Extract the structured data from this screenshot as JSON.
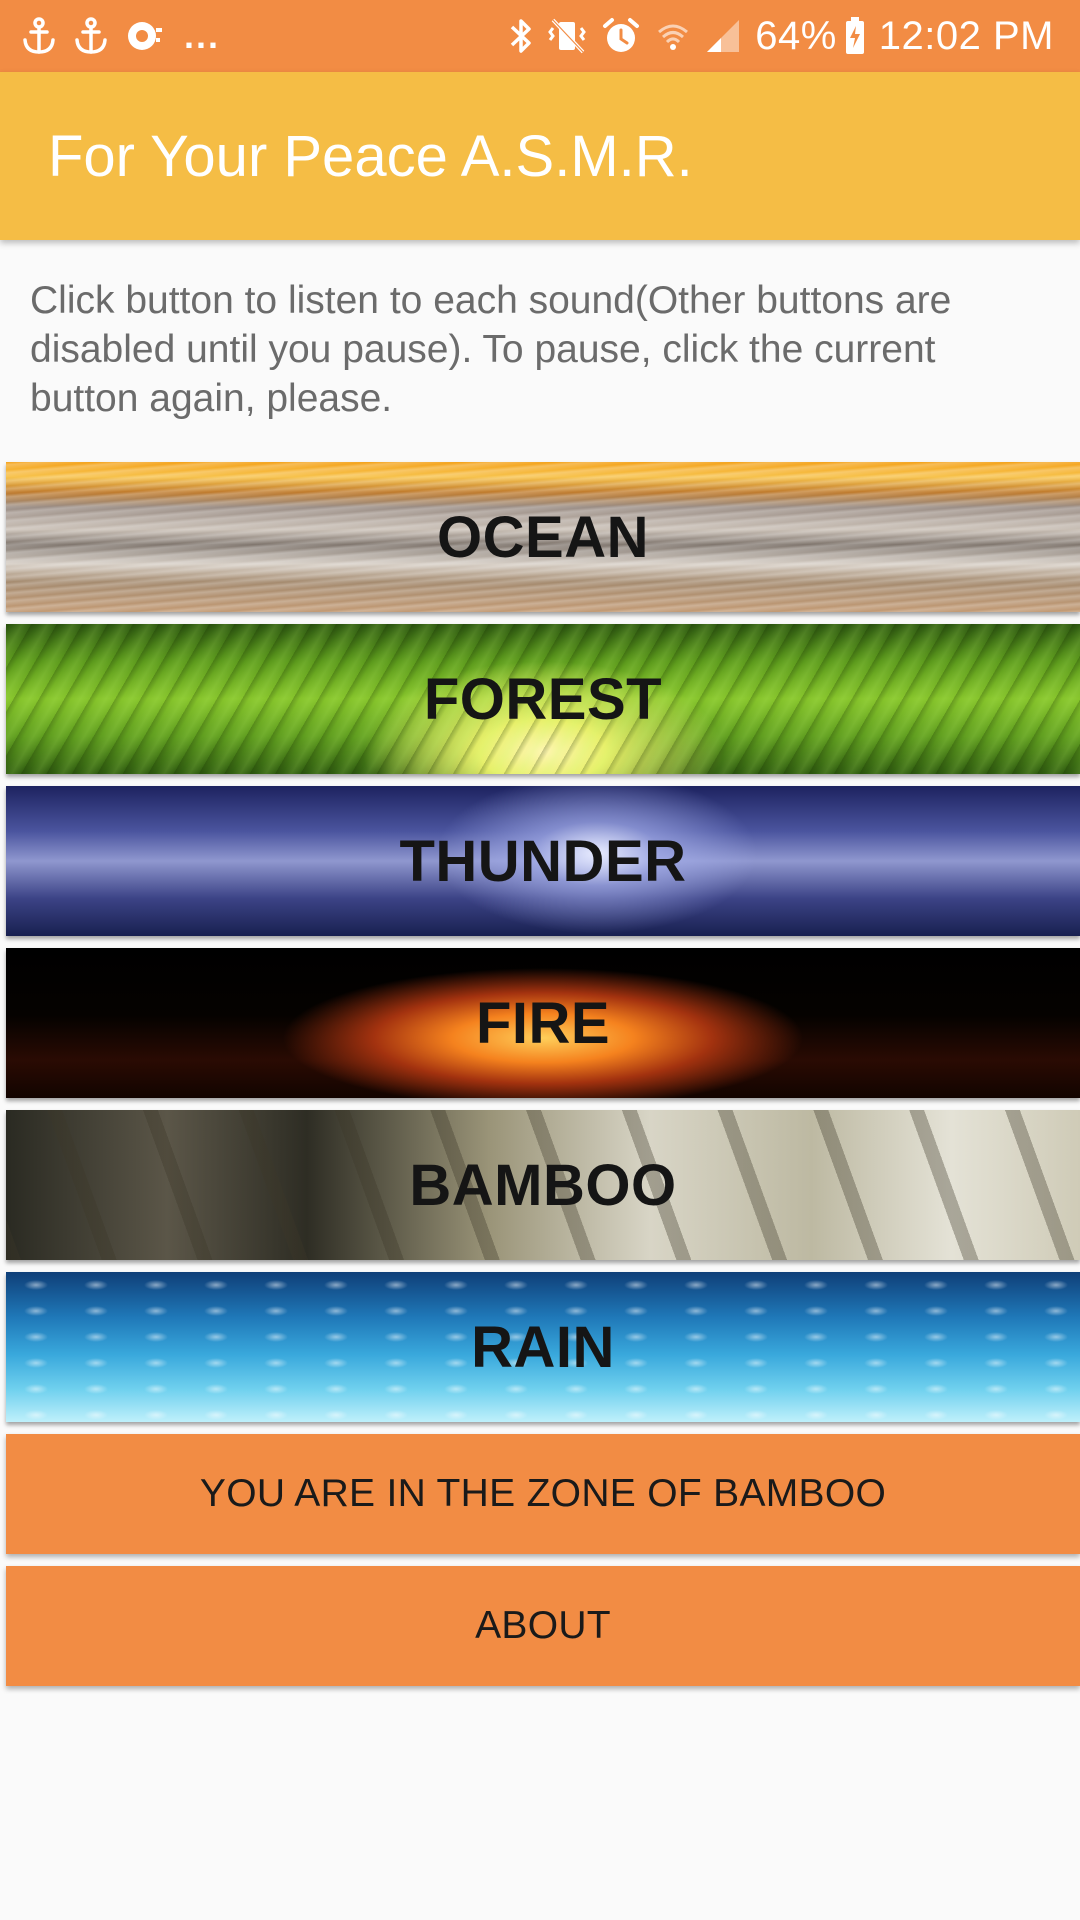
{
  "status_bar": {
    "left_icons": [
      "anchor-icon",
      "anchor-icon",
      "notification-icon"
    ],
    "more": "...",
    "right_icons": [
      "bluetooth-icon",
      "vibrate-mute-icon",
      "alarm-icon",
      "wifi-icon",
      "signal-icon"
    ],
    "battery": "64%",
    "time": "12:02 PM"
  },
  "app_bar": {
    "title": "For Your Peace A.S.M.R.",
    "color": "#f5bd45"
  },
  "instructions": "Click button to listen to each sound(Other buttons are disabled until you pause). To pause, click the current button again, please.",
  "sounds": [
    {
      "label": "OCEAN"
    },
    {
      "label": "FOREST"
    },
    {
      "label": "THUNDER"
    },
    {
      "label": "FIRE"
    },
    {
      "label": "BAMBOO"
    },
    {
      "label": "RAIN"
    }
  ],
  "zone_button": "YOU ARE IN THE ZONE OF BAMBOO",
  "about_button": "ABOUT",
  "accent_color": "#f28c44"
}
